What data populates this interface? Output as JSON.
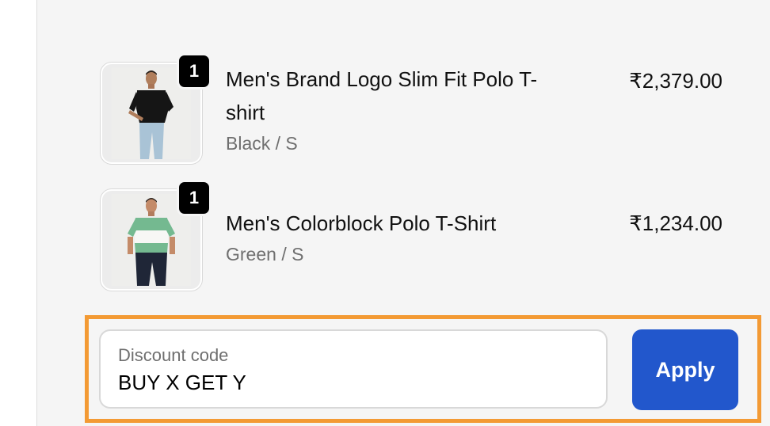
{
  "cart_items": [
    {
      "quantity": "1",
      "title_line1": "Men's Brand Logo Slim Fit Polo T-",
      "title_line2": "shirt",
      "variant": "Black / S",
      "price": "₹2,379.00"
    },
    {
      "quantity": "1",
      "title_line1": "Men's Colorblock Polo T-Shirt",
      "variant": "Green / S",
      "price": "₹1,234.00"
    }
  ],
  "discount": {
    "label": "Discount code",
    "value": "BUY X GET Y",
    "apply_label": "Apply"
  },
  "colors": {
    "accent": "#2257cc",
    "highlight": "#f39a34",
    "badge": "#000000"
  }
}
